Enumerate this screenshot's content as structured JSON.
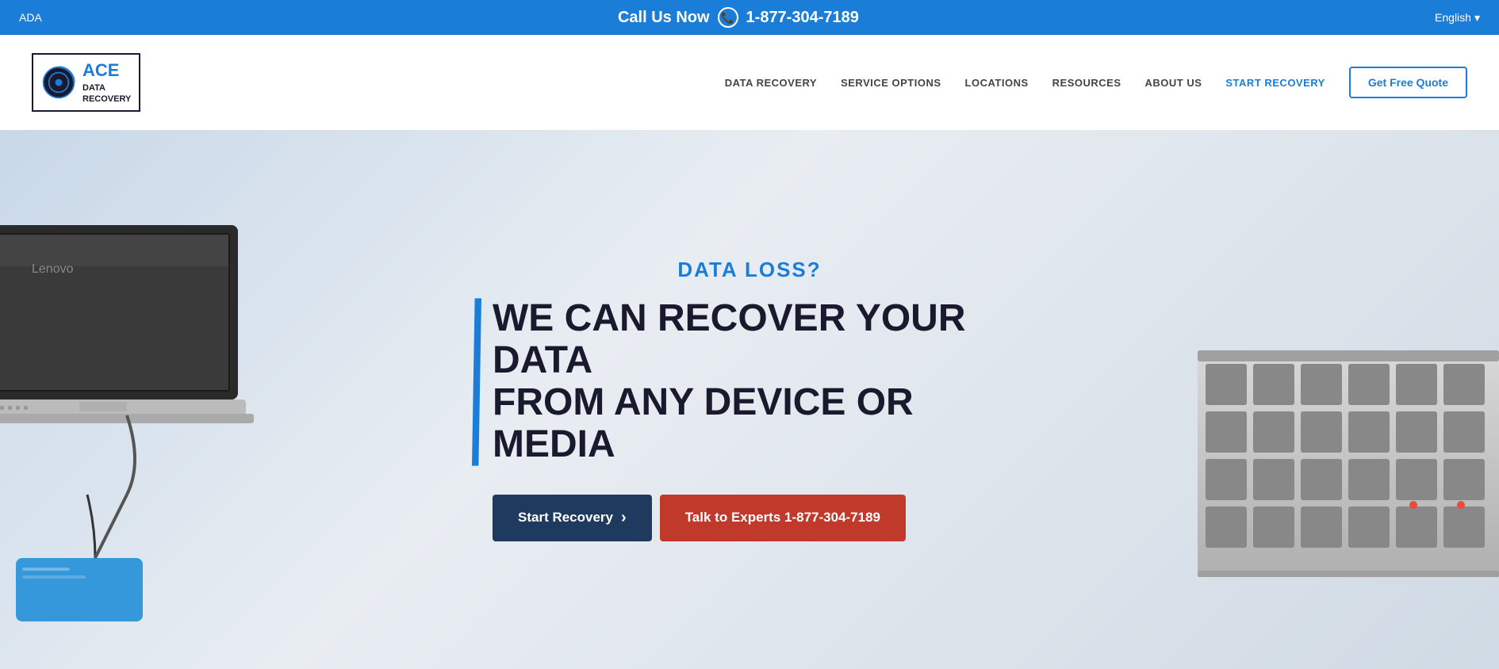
{
  "topbar": {
    "left_label": "ADA",
    "call_label": "Call Us Now",
    "phone_number": "1-877-304-7189",
    "language": "English",
    "chevron": "▾"
  },
  "navbar": {
    "logo": {
      "brand_large": "ace",
      "line1": "DATA",
      "line2": "RECOVERY"
    },
    "links": [
      {
        "label": "DATA RECOVERY",
        "active": false
      },
      {
        "label": "SERVICE OPTIONS",
        "active": false
      },
      {
        "label": "LOCATIONS",
        "active": false
      },
      {
        "label": "RESOURCES",
        "active": false
      },
      {
        "label": "ABOUT US",
        "active": false
      },
      {
        "label": "START RECOVERY",
        "active": true
      }
    ],
    "cta_button": "Get Free Quote"
  },
  "hero": {
    "subtitle": "DATA LOSS?",
    "title_line1": "WE CAN RECOVER YOUR DATA",
    "title_line2": "FROM ANY DEVICE OR MEDIA",
    "btn_start": "Start Recovery",
    "btn_chevron": "›",
    "btn_experts": "Talk to Experts 1-877-304-7189"
  }
}
